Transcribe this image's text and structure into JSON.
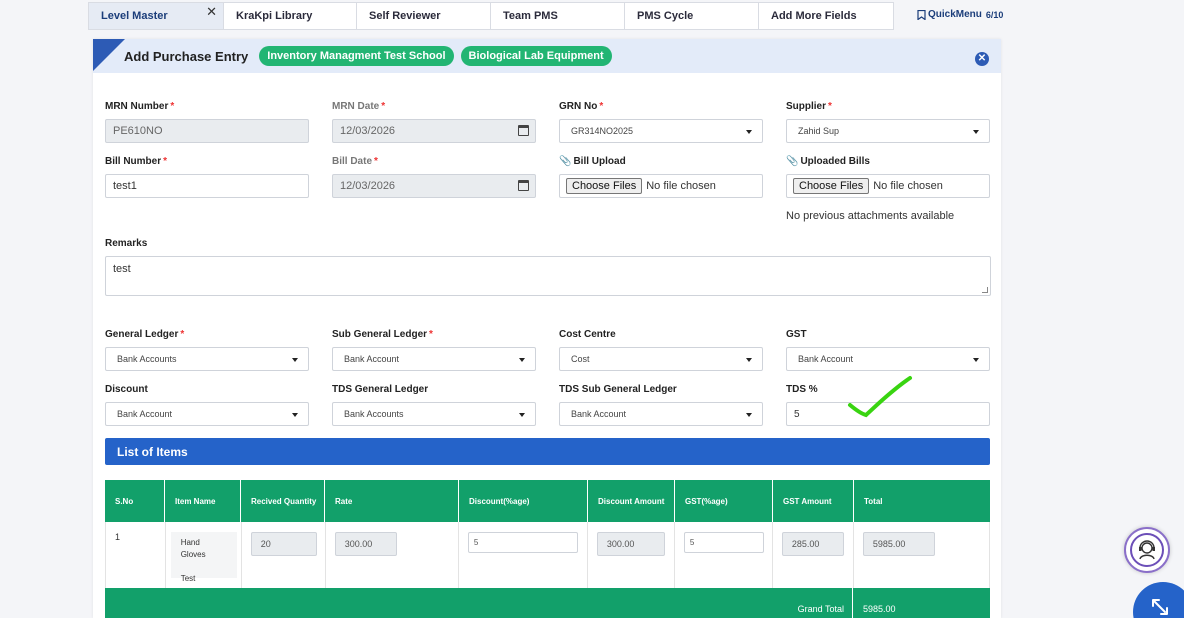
{
  "tabs": [
    {
      "label": "Level Master",
      "active": true,
      "close": "✕"
    },
    {
      "label": "KraKpi Library"
    },
    {
      "label": "Self Reviewer"
    },
    {
      "label": "Team PMS"
    },
    {
      "label": "PMS Cycle"
    },
    {
      "label": "Add More Fields"
    }
  ],
  "quickmenu": {
    "label": "QuickMenu",
    "count": "6/10"
  },
  "card": {
    "title": "Add Purchase Entry",
    "pills": [
      "Inventory Managment Test School",
      "Biological Lab Equipment"
    ],
    "close": "✕"
  },
  "form": {
    "mrn_number": {
      "label": "MRN Number",
      "value": "PE610NO"
    },
    "mrn_date": {
      "label": "MRN Date",
      "value": "12/03/2026"
    },
    "grn_no": {
      "label": "GRN No",
      "value": "GR314NO2025"
    },
    "supplier": {
      "label": "Supplier",
      "value": "Zahid Sup"
    },
    "bill_number": {
      "label": "Bill Number",
      "value": "test1"
    },
    "bill_date": {
      "label": "Bill Date",
      "value": "12/03/2026"
    },
    "bill_upload": {
      "label": "Bill Upload",
      "button": "Choose Files",
      "status": "No file chosen"
    },
    "uploaded_bills": {
      "label": "Uploaded Bills",
      "button": "Choose Files",
      "status": "No file chosen",
      "note": "No previous attachments available"
    },
    "remarks": {
      "label": "Remarks",
      "value": "test"
    },
    "general_ledger": {
      "label": "General Ledger",
      "value": "Bank Accounts"
    },
    "sub_general_ledger": {
      "label": "Sub General Ledger",
      "value": "Bank Account"
    },
    "cost_centre": {
      "label": "Cost Centre",
      "value": "Cost"
    },
    "gst": {
      "label": "GST",
      "value": "Bank Account"
    },
    "discount": {
      "label": "Discount",
      "value": "Bank Account"
    },
    "tds_general_ledger": {
      "label": "TDS General Ledger",
      "value": "Bank Accounts"
    },
    "tds_sub_general_ledger": {
      "label": "TDS Sub General Ledger",
      "value": "Bank Account"
    },
    "tds_percent": {
      "label": "TDS %",
      "value": "5"
    },
    "required_mark": "*"
  },
  "items": {
    "title": "List of Items",
    "columns": [
      "S.No",
      "Item Name",
      "Recived Quantity",
      "Rate",
      "Discount(%age)",
      "Discount Amount",
      "GST(%age)",
      "GST Amount",
      "Total"
    ],
    "rows": [
      {
        "sno": "1",
        "item_name_1": "Hand Gloves",
        "item_name_2": "Test",
        "qty": "20",
        "rate": "300.00",
        "discount_pct": "5",
        "discount_amt": "300.00",
        "gst_pct": "5",
        "gst_amt": "285.00",
        "total": "5985.00"
      }
    ],
    "grand_total_label": "Grand Total",
    "grand_total_value": "5985.00"
  },
  "colors": {
    "accent": "#2563c9",
    "green": "#12a06a",
    "pill": "#22b573",
    "check": "#39d411"
  },
  "icons": [
    "bookmark-icon",
    "calendar-icon",
    "paperclip-icon",
    "dropdown-caret-icon",
    "close-icon",
    "support-agent-icon",
    "expand-icon",
    "checkmark-icon"
  ]
}
